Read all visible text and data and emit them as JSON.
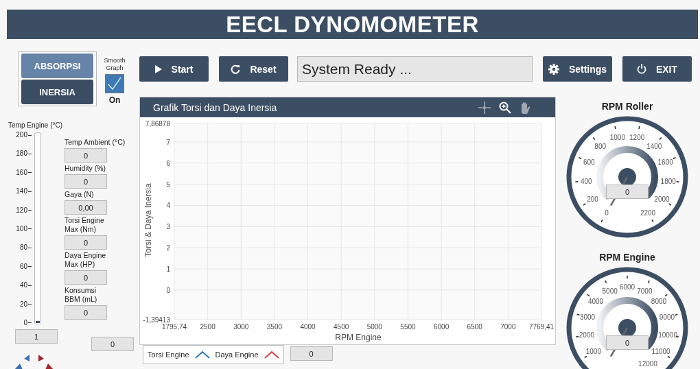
{
  "header": {
    "title": "EECL DYNOMOMETER"
  },
  "mode_buttons": [
    {
      "label": "ABSORPSI",
      "selected": false
    },
    {
      "label": "INERSIA",
      "selected": true
    }
  ],
  "smooth_graph": {
    "label": "Smooth Graph",
    "checked": true,
    "state_text": "On"
  },
  "temp_engine": {
    "label": "Temp Engine (°C)",
    "scale": [
      "200",
      "180",
      "160",
      "140",
      "120",
      "100",
      "80",
      "60",
      "40",
      "20",
      "0"
    ],
    "level": 0.01,
    "value": "1"
  },
  "readings": [
    {
      "label": "Temp Ambient (°C)",
      "value": "0"
    },
    {
      "label": "Humidity (%)",
      "value": "0"
    },
    {
      "label": "Gaya (N)",
      "value": "0,00"
    },
    {
      "label": "Torsi Engine\nMax (Nm)",
      "value": "0"
    },
    {
      "label": "Daya Engine\nMax (HP)",
      "value": "0"
    },
    {
      "label": "Konsumsi\nBBM (mL)",
      "value": "0"
    }
  ],
  "indicator_left": {
    "value": "0"
  },
  "toolbar": {
    "buttons": [
      {
        "label": "Start",
        "kind": "play"
      },
      {
        "label": "Reset",
        "kind": "reset"
      }
    ],
    "status": "System Ready ...",
    "right_buttons": [
      {
        "label": "Settings",
        "kind": "gear"
      },
      {
        "label": "EXIT",
        "kind": "power"
      }
    ]
  },
  "chart": {
    "title": "Grafik Torsi dan Daya Inersia",
    "chart_data": {
      "type": "line",
      "xlabel": "RPM Engine",
      "ylabel": "Torsi & Daya Inersia",
      "ylim": [
        -1.39413,
        7.86878
      ],
      "grid": true,
      "categories": [
        "1795,74",
        "2500",
        "3000",
        "3500",
        "4000",
        "4500",
        "5000",
        "5500",
        "6000",
        "6500",
        "7000",
        "7769,41"
      ],
      "yticks": [
        {
          "value": 7.86878,
          "label": "7,86878"
        },
        7,
        6,
        5,
        4,
        3,
        2,
        1,
        0,
        {
          "value": -1.39413,
          "label": "-1,39413"
        }
      ],
      "series": [
        {
          "name": "Torsi Engine",
          "color": "#2a7ab8",
          "values": [
            null,
            null,
            null,
            null,
            null,
            null,
            null,
            null,
            null,
            null,
            null,
            null
          ]
        },
        {
          "name": "Daya Engine",
          "color": "#d24040",
          "values": [
            null,
            null,
            null,
            null,
            null,
            null,
            null,
            null,
            null,
            null,
            null,
            null
          ]
        }
      ]
    }
  },
  "indicator_chart": {
    "value": "0"
  },
  "gauges": [
    {
      "title": "RPM Roller",
      "labels": [
        "0",
        "200",
        "400",
        "600",
        "800",
        "1000",
        "1200",
        "1400",
        "1600",
        "1800",
        "2000",
        "2200"
      ],
      "value": "0"
    },
    {
      "title": "RPM Engine",
      "labels": [
        "1000",
        "2000",
        "3000",
        "4000",
        "5000",
        "6000",
        "7000",
        "8000",
        "9000",
        "10000",
        "11000",
        "12000"
      ],
      "value": "0"
    }
  ]
}
